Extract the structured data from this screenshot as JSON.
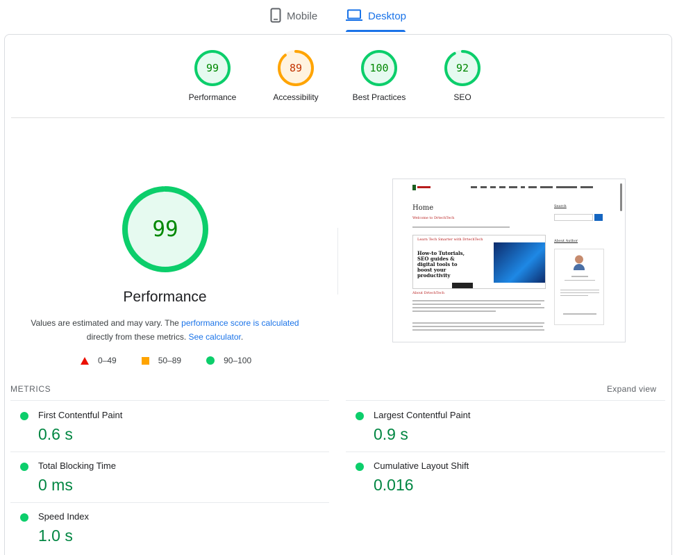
{
  "tabs": {
    "mobile": {
      "label": "Mobile",
      "icon": "phone-icon"
    },
    "desktop": {
      "label": "Desktop",
      "icon": "laptop-icon",
      "active": true
    }
  },
  "categories": [
    {
      "label": "Performance",
      "score": "99",
      "fraction": 0.99,
      "status": "pass"
    },
    {
      "label": "Accessibility",
      "score": "89",
      "fraction": 0.89,
      "status": "average"
    },
    {
      "label": "Best Practices",
      "score": "100",
      "fraction": 1.0,
      "status": "pass"
    },
    {
      "label": "SEO",
      "score": "92",
      "fraction": 0.92,
      "status": "pass"
    }
  ],
  "performance": {
    "score": "99",
    "fraction": 0.99,
    "title": "Performance",
    "note_prefix": "Values are estimated and may vary. The ",
    "note_link": "performance score is calculated",
    "note_middle": "directly from these metrics. ",
    "note_calc_link": "See calculator",
    "note_end": "."
  },
  "legend": {
    "fail": "0–49",
    "average": "50–89",
    "pass": "90–100"
  },
  "screenshot": {
    "page_heading": "Home",
    "welcome": "Welcome to DrtechTech",
    "about_heading": "About DrtechTech",
    "banner_top": "Learn Tech Smarter with DrtechTech",
    "banner_text": "How-to Tutorials, SEO guides & digital tools to boost your productivity",
    "search_heading": "Search",
    "author_heading": "About Author"
  },
  "metrics": {
    "heading": "METRICS",
    "expand_label": "Expand view",
    "items": [
      {
        "name": "First Contentful Paint",
        "value": "0.6 s"
      },
      {
        "name": "Largest Contentful Paint",
        "value": "0.9 s"
      },
      {
        "name": "Total Blocking Time",
        "value": "0 ms"
      },
      {
        "name": "Cumulative Layout Shift",
        "value": "0.016"
      },
      {
        "name": "Speed Index",
        "value": "1.0 s"
      }
    ]
  },
  "colors": {
    "pass": "#0cce6b",
    "pass_fill": "#e6faf0",
    "pass_text": "#008800",
    "average": "#ffa400",
    "average_fill": "#fff3e0",
    "average_text": "#c33300",
    "fail": "#eb0f00",
    "accent": "#1a73e8"
  }
}
